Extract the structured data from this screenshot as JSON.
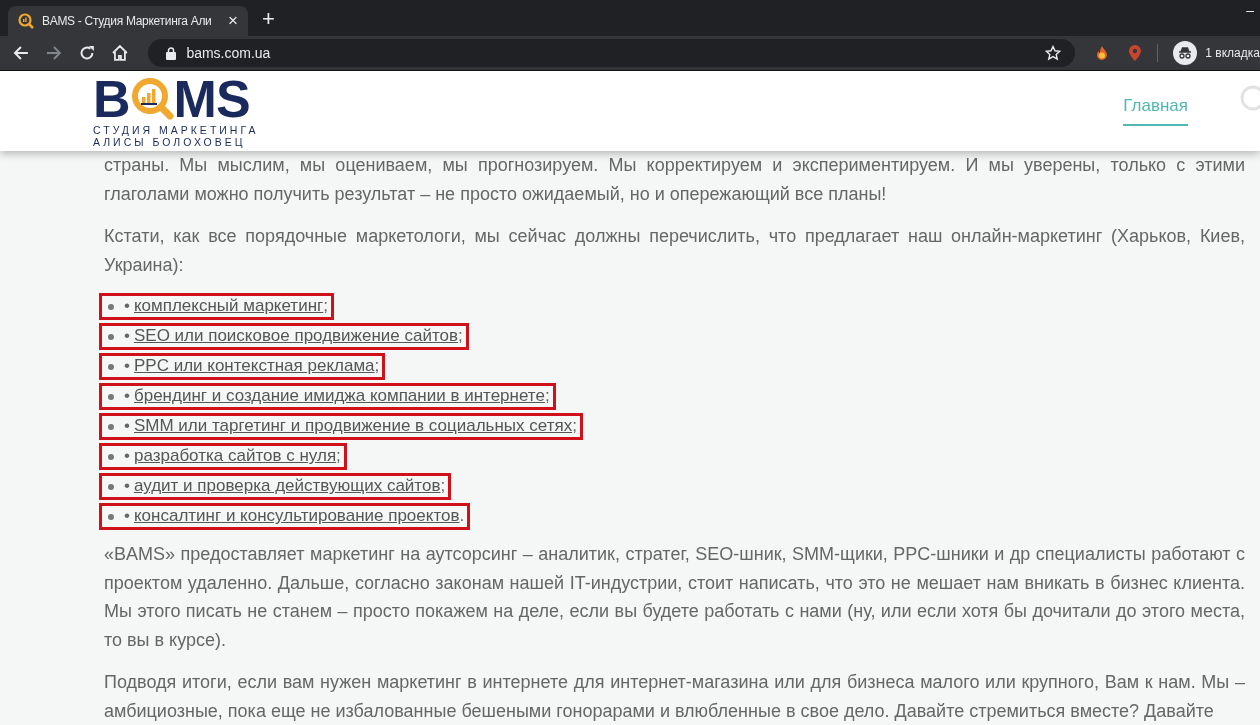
{
  "browser": {
    "tab_title": "BAMS - Студия Маркетинга Али",
    "tab_close": "×",
    "new_tab": "+",
    "url": "bams.com.ua",
    "profile_label": "1 вкладка",
    "window_minimize": "–"
  },
  "header": {
    "logo": {
      "left": "B",
      "right": "MS",
      "tagline_1": "СТУДИЯ МАРКЕТИНГА",
      "tagline_2": "АЛИСЫ БОЛОХОВЕЦ"
    },
    "nav": [
      {
        "label": "Главная",
        "selected": true
      }
    ]
  },
  "paragraphs_top": [
    "страны. Мы мыслим, мы оцениваем, мы прогнозируем. Мы корректируем и экспериментируем. И мы уверены, только с этими глаголами можно получить результат – не просто ожидаемый, но и опережающий все планы!",
    "Кстати, как все порядочные маркетологи, мы сейчас должны перечислить, что предлагает наш онлайн-маркетинг (Харьков, Киев, Украина):"
  ],
  "services": [
    {
      "bullet": "•",
      "link": "комплексный маркетинг",
      "suffix": ";",
      "highlighted": true
    },
    {
      "bullet": "•",
      "link": "SEO или поисковое продвижение сайтов",
      "suffix": ";",
      "highlighted": true
    },
    {
      "bullet": "•",
      "link": "PPC или контекстная реклама",
      "suffix": ";",
      "highlighted": true
    },
    {
      "bullet": "•",
      "link": "брендинг и создание имиджа компании в интернете",
      "suffix": ";",
      "highlighted": true
    },
    {
      "bullet": "•",
      "link": "SMM или таргетинг и продвижение в социальных сетях",
      "suffix": ";",
      "highlighted": true
    },
    {
      "bullet": "•",
      "link": "разработка сайтов с нуля",
      "suffix": ";",
      "highlighted": true
    },
    {
      "bullet": "•",
      "link": "аудит и проверка действующих сайтов",
      "suffix": ";",
      "highlighted": true
    },
    {
      "bullet": "•",
      "link": "консалтинг и консультирование проектов",
      "suffix": ".",
      "highlighted": true
    }
  ],
  "paragraphs_bottom": [
    "«BAMS» предоставляет маркетинг на аутсорсинг – аналитик, стратег, SEO-шник, SMM-щики, PPC-шники и др специалисты работают с проектом удаленно. Дальше, согласно законам нашей IT-индустрии, стоит написать, что это не мешает нам вникать в бизнес клиента. Мы этого писать не станем – просто покажем на деле, если вы будете работать с нами (ну, или если хотя бы дочитали до этого места, то вы в курсе).",
    "Подводя итоги, если вам нужен маркетинг в интернете для интернет-магазина или для бизнеса малого или крупного, Вам к нам. Мы – амбициозные, пока еще не избалованные бешеными гонорарами и влюбленные в свое дело. Давайте стремиться вместе? Давайте"
  ]
}
